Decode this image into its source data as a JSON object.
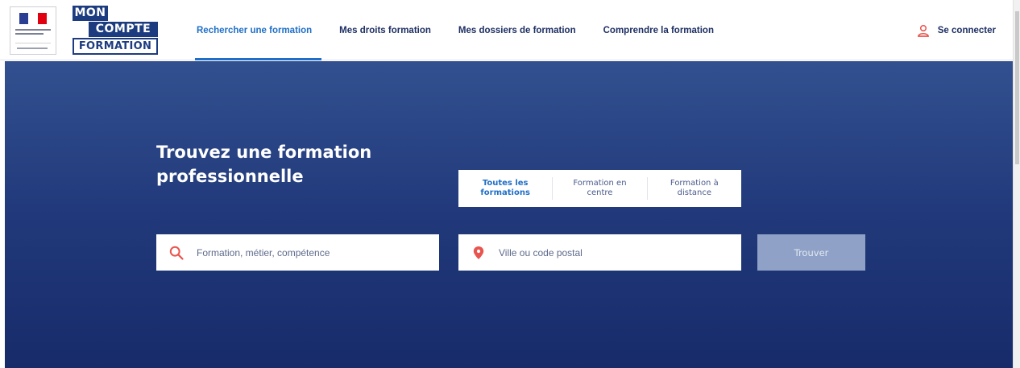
{
  "brand": {
    "line1": "MON",
    "line2": "COMPTE",
    "line3": "FORMATION"
  },
  "nav": {
    "items": [
      {
        "label": "Rechercher une formation",
        "active": true
      },
      {
        "label": "Mes droits formation"
      },
      {
        "label": "Mes dossiers de formation"
      },
      {
        "label": "Comprendre la formation"
      }
    ],
    "login_label": "Se connecter"
  },
  "hero": {
    "title_line1": "Trouvez une formation",
    "title_line2": "professionnelle"
  },
  "tabs": [
    {
      "line1": "Toutes les",
      "line2": "formations",
      "active": true
    },
    {
      "line1": "Formation en",
      "line2": "centre"
    },
    {
      "line1": "Formation à",
      "line2": "distance"
    }
  ],
  "search": {
    "what_placeholder": "Formation, métier, compétence",
    "where_placeholder": "Ville ou code postal",
    "submit_label": "Trouver"
  },
  "colors": {
    "primary": "#1d3c80",
    "accent": "#1f6fc7",
    "icon": "#e8554e",
    "button_disabled": "#8fa1c6"
  },
  "icons": {
    "login": "user-icon",
    "what": "search-icon",
    "where": "location-pin-icon"
  }
}
